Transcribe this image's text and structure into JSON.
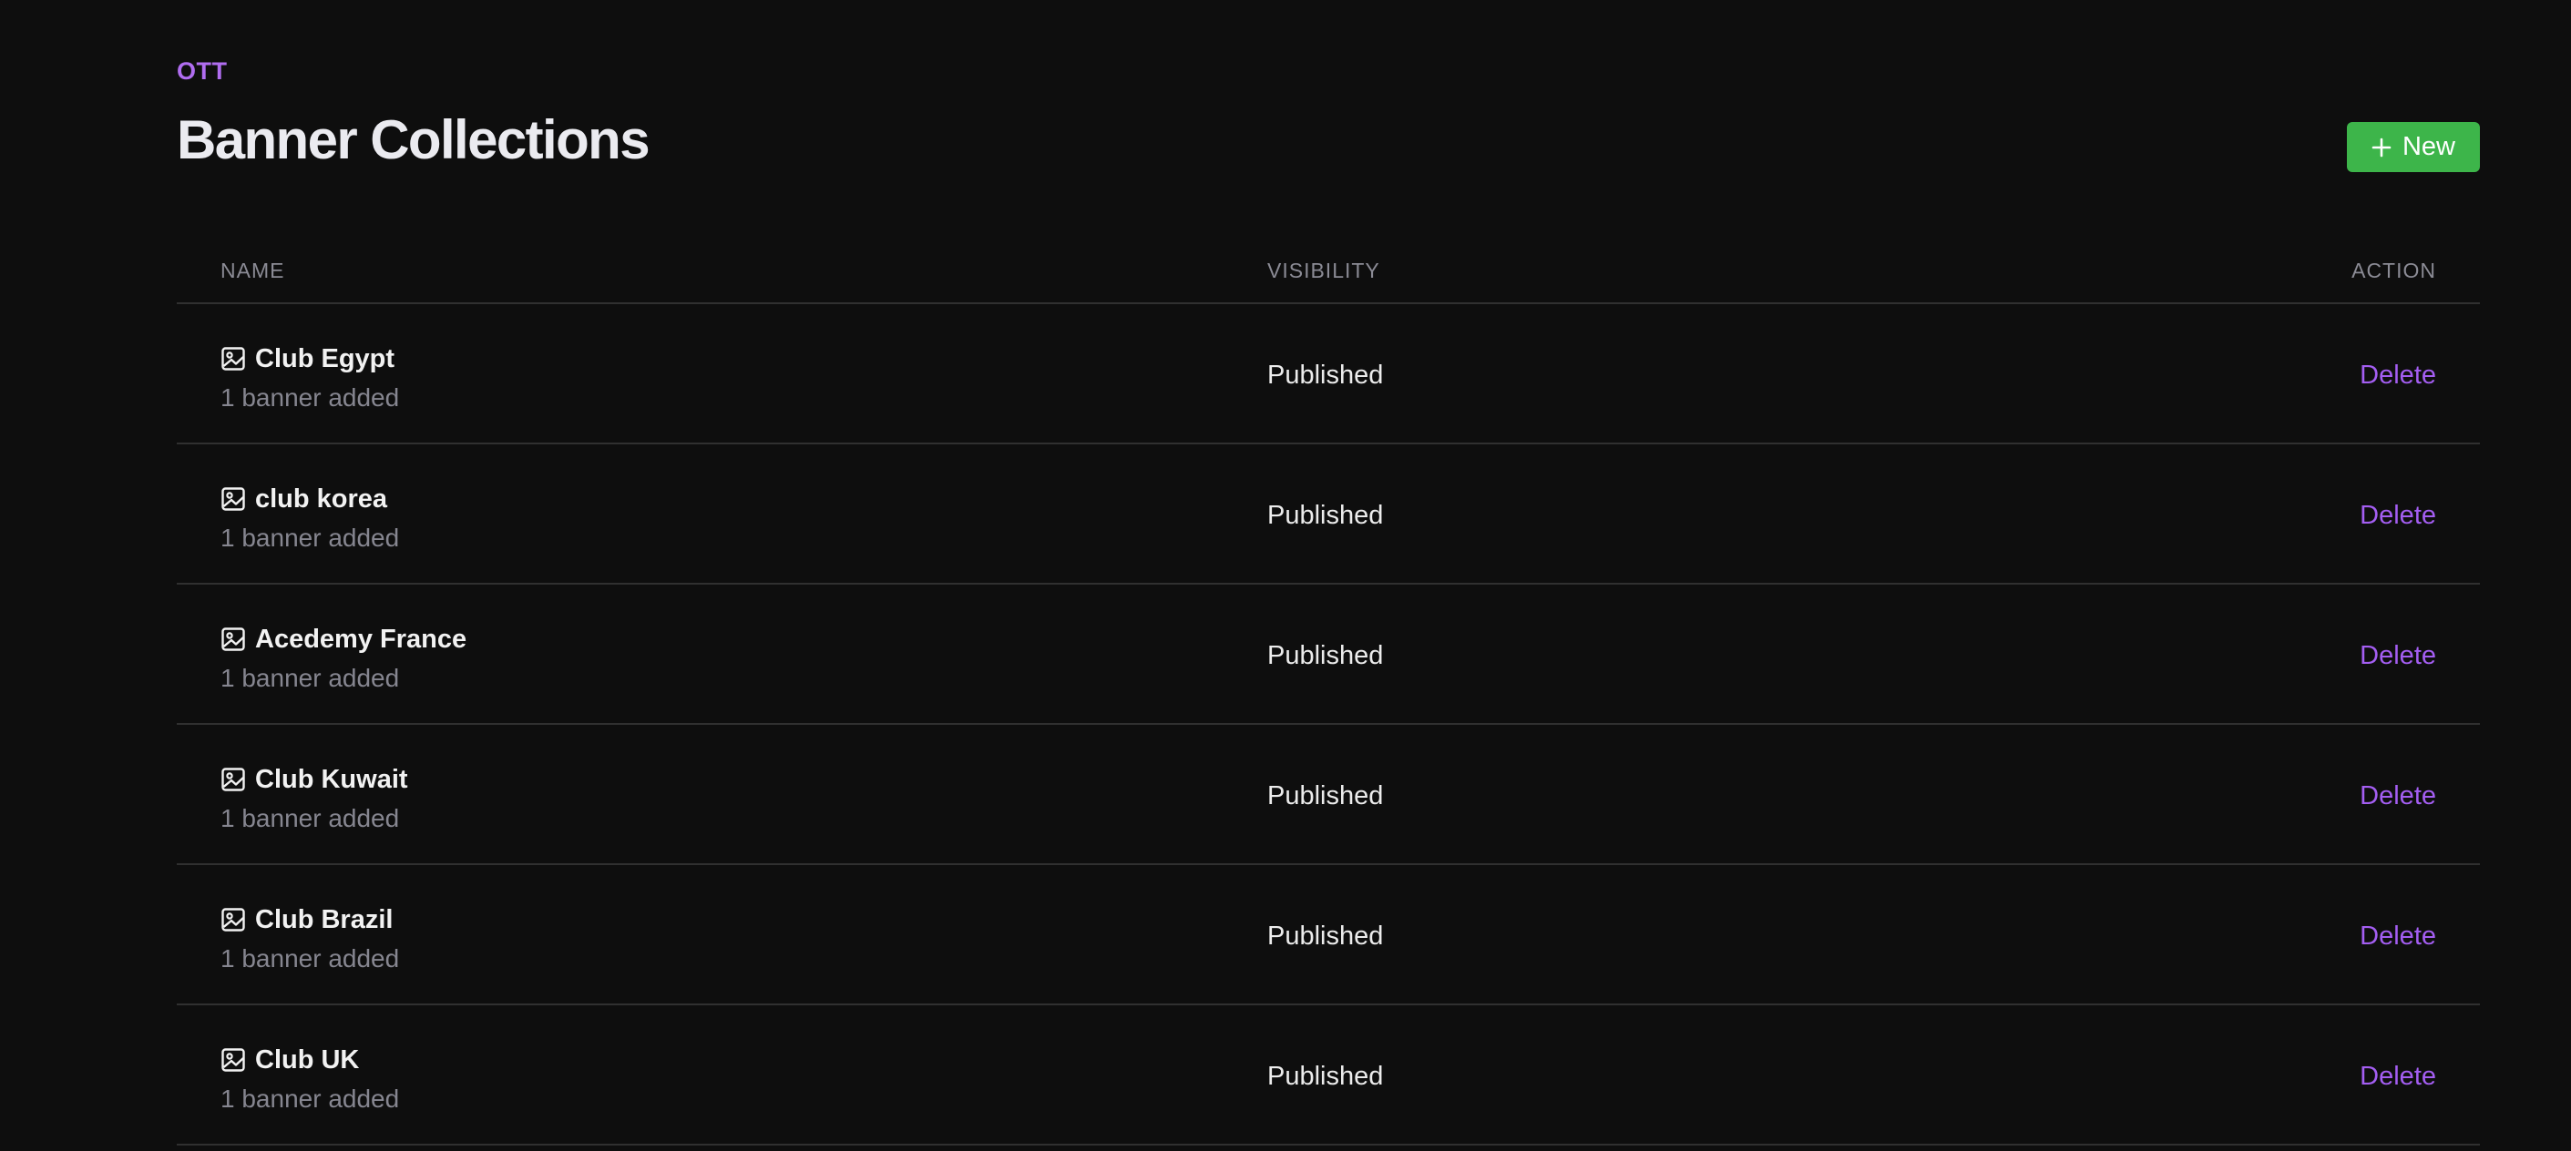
{
  "header": {
    "eyebrow": "OTT",
    "title": "Banner Collections",
    "new_button_label": "New",
    "new_button_icon": "plus-icon"
  },
  "colors": {
    "background": "#0e0e0e",
    "accent_purple": "#b06df0",
    "delete_purple": "#a45ef2",
    "new_button_green": "#3db54a",
    "divider": "#303030"
  },
  "table": {
    "columns": {
      "name": "NAME",
      "visibility": "VISIBILITY",
      "action": "ACTION"
    },
    "row_icon": "image-icon",
    "rows": [
      {
        "name": "Club Egypt",
        "subtitle": "1 banner added",
        "visibility": "Published",
        "action": "Delete"
      },
      {
        "name": "club korea",
        "subtitle": "1 banner added",
        "visibility": "Published",
        "action": "Delete"
      },
      {
        "name": "Acedemy France",
        "subtitle": "1 banner added",
        "visibility": "Published",
        "action": "Delete"
      },
      {
        "name": "Club Kuwait",
        "subtitle": "1 banner added",
        "visibility": "Published",
        "action": "Delete"
      },
      {
        "name": "Club Brazil",
        "subtitle": "1 banner added",
        "visibility": "Published",
        "action": "Delete"
      },
      {
        "name": "Club UK",
        "subtitle": "1 banner added",
        "visibility": "Published",
        "action": "Delete"
      }
    ]
  }
}
